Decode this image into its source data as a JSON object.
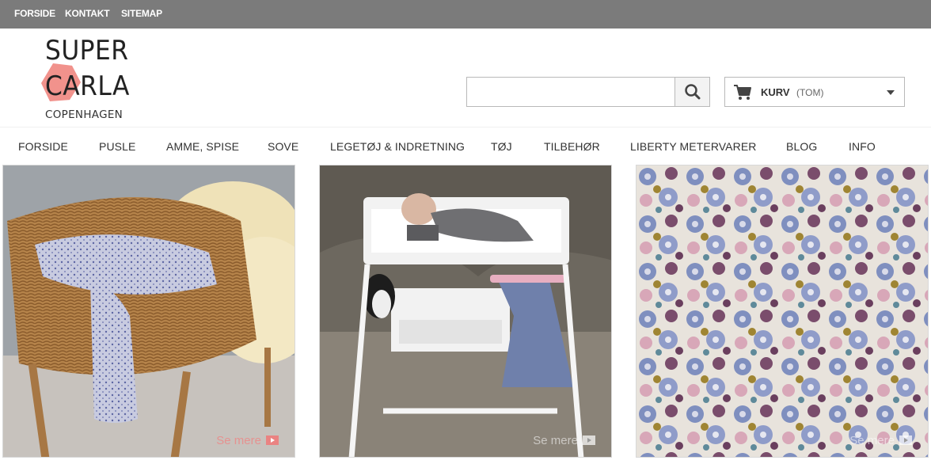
{
  "topbar": {
    "links": [
      "FORSIDE",
      "KONTAKT",
      "SITEMAP"
    ]
  },
  "logo": {
    "line1": "SUPER",
    "line2": "CARLA",
    "line3": "COPENHAGEN"
  },
  "search": {
    "placeholder": "",
    "value": ""
  },
  "cart": {
    "label": "KURV",
    "status": "(TOM)"
  },
  "nav": {
    "items": [
      "FORSIDE",
      "PUSLE",
      "AMME, SPISE",
      "SOVE",
      "LEGETØJ & INDRETNING",
      "TØJ",
      "TILBEHØR",
      "LIBERTY METERVARER",
      "BLOG",
      "INFO"
    ]
  },
  "tiles": [
    {
      "cta": "Se mere"
    },
    {
      "cta": "Se mere"
    },
    {
      "cta": "Se mere"
    }
  ],
  "colors": {
    "topbar": "#7b7b7b",
    "logo_accent": "#f1928c"
  }
}
